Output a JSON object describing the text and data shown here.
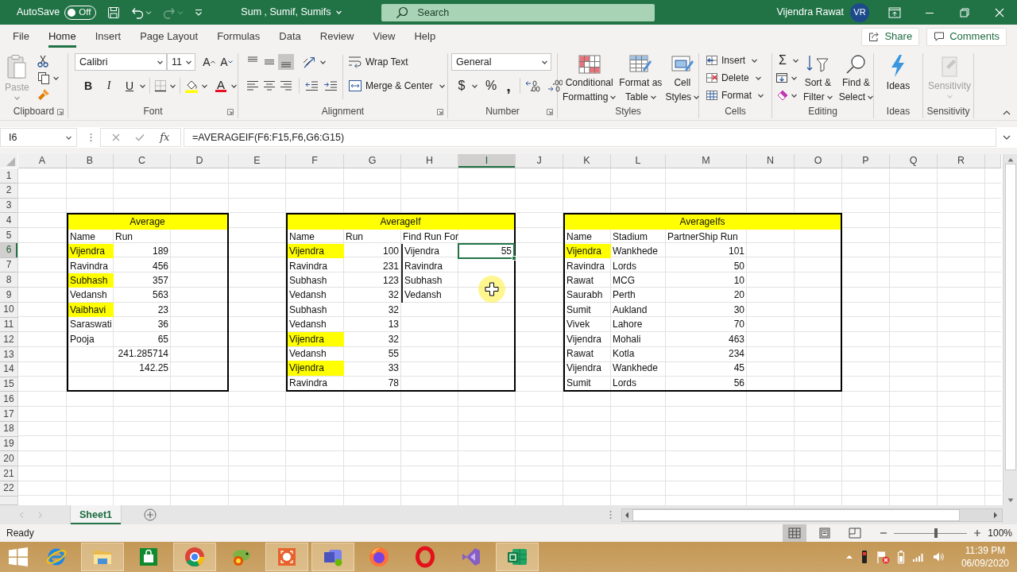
{
  "title_bar": {
    "autosave": {
      "label": "AutoSave",
      "on": false,
      "state_label": "Off"
    },
    "redo": {
      "disabled": true
    },
    "title": "Sum , Sumif, Sumifs",
    "search": {
      "placeholder": "Search"
    },
    "user": "Vijendra Rawat",
    "initials": "VR"
  },
  "menu": {
    "tabs": [
      {
        "label": "File",
        "selected": false
      },
      {
        "label": "Home",
        "selected": true
      },
      {
        "label": "Insert",
        "selected": false
      },
      {
        "label": "Page Layout",
        "selected": false
      },
      {
        "label": "Formulas",
        "selected": false
      },
      {
        "label": "Data",
        "selected": false
      },
      {
        "label": "Review",
        "selected": false
      },
      {
        "label": "View",
        "selected": false
      },
      {
        "label": "Help",
        "selected": false
      }
    ],
    "share": "Share",
    "comments": "Comments"
  },
  "ribbon": {
    "groups": [
      {
        "kind": "clipboard",
        "label": "Clipboard",
        "paste": {
          "label": "Paste",
          "disabled": true
        }
      },
      {
        "kind": "font",
        "label": "Font",
        "font": "Calibri",
        "size": "11",
        "grow": "A",
        "shrink": "A",
        "bold": "B",
        "italic": "I",
        "underline": "U",
        "font_color": "A"
      },
      {
        "kind": "alignment",
        "label": "Alignment",
        "vertical": [
          {
            "selected": false
          },
          {
            "selected": false
          },
          {
            "selected": true
          }
        ],
        "horizontal": [
          {
            "selected": false
          },
          {
            "selected": false
          },
          {
            "selected": false
          }
        ],
        "wrap": "Wrap Text",
        "merge": "Merge & Center"
      },
      {
        "kind": "number",
        "label": "Number",
        "format": "General",
        "currency": "$",
        "percent": "%",
        "comma": ","
      },
      {
        "kind": "styles",
        "label": "Styles",
        "buttons": [
          {
            "lines": [
              "Conditional",
              "Formatting"
            ]
          },
          {
            "lines": [
              "Format as",
              "Table"
            ]
          },
          {
            "lines": [
              "Cell",
              "Styles"
            ]
          }
        ]
      },
      {
        "kind": "cells",
        "label": "Cells",
        "buttons": [
          "Insert",
          "Delete",
          "Format"
        ]
      },
      {
        "kind": "editing",
        "label": "Editing",
        "autosum": "Σ",
        "buttons": [
          {
            "lines": [
              "Sort &",
              "Filter"
            ]
          },
          {
            "lines": [
              "Find &",
              "Select"
            ]
          }
        ]
      },
      {
        "kind": "ideas",
        "label": "Ideas",
        "button": "Ideas"
      },
      {
        "kind": "sensitivity",
        "label": "Sensitivity",
        "button": "Sensitivity",
        "disabled": true
      }
    ]
  },
  "formula_bar": {
    "name_box": "I6",
    "function_label": "fx",
    "formula": "=AVERAGEIF(F6:F15,F6,G6:G15)"
  },
  "sheet": {
    "columns": [
      {
        "label": "A",
        "selected": false
      },
      {
        "label": "B",
        "selected": false
      },
      {
        "label": "C",
        "selected": false
      },
      {
        "label": "D",
        "selected": false
      },
      {
        "label": "E",
        "selected": false
      },
      {
        "label": "F",
        "selected": false
      },
      {
        "label": "G",
        "selected": false
      },
      {
        "label": "H",
        "selected": false
      },
      {
        "label": "I",
        "selected": true
      },
      {
        "label": "J",
        "selected": false
      },
      {
        "label": "K",
        "selected": false
      },
      {
        "label": "L",
        "selected": false
      },
      {
        "label": "M",
        "selected": false
      },
      {
        "label": "N",
        "selected": false
      },
      {
        "label": "O",
        "selected": false
      },
      {
        "label": "P",
        "selected": false
      },
      {
        "label": "Q",
        "selected": false
      },
      {
        "label": "R",
        "selected": false
      }
    ],
    "rows": [
      {
        "label": "1",
        "selected": false
      },
      {
        "label": "2",
        "selected": false
      },
      {
        "label": "3",
        "selected": false
      },
      {
        "label": "4",
        "selected": false
      },
      {
        "label": "5",
        "selected": false
      },
      {
        "label": "6",
        "selected": true
      },
      {
        "label": "7",
        "selected": false
      },
      {
        "label": "8",
        "selected": false
      },
      {
        "label": "9",
        "selected": false
      },
      {
        "label": "10",
        "selected": false
      },
      {
        "label": "11",
        "selected": false
      },
      {
        "label": "12",
        "selected": false
      },
      {
        "label": "13",
        "selected": false
      },
      {
        "label": "14",
        "selected": false
      },
      {
        "label": "15",
        "selected": false
      },
      {
        "label": "16",
        "selected": false
      },
      {
        "label": "17",
        "selected": false
      },
      {
        "label": "18",
        "selected": false
      },
      {
        "label": "19",
        "selected": false
      },
      {
        "label": "20",
        "selected": false
      },
      {
        "label": "21",
        "selected": false
      },
      {
        "label": "22",
        "selected": false
      }
    ],
    "tables": [
      {
        "kind": "average",
        "title": "Average",
        "header": [
          "Name",
          "Run"
        ],
        "rows": [
          {
            "name": "Vijendra",
            "run": "189",
            "highlighted": true
          },
          {
            "name": "Ravindra",
            "run": "456",
            "highlighted": false
          },
          {
            "name": "Subhash",
            "run": "357",
            "highlighted": true
          },
          {
            "name": "Vedansh",
            "run": "563",
            "highlighted": false
          },
          {
            "name": "Vaibhavi",
            "run": "23",
            "highlighted": true
          },
          {
            "name": "Saraswati",
            "run": "36",
            "highlighted": false
          },
          {
            "name": "Pooja",
            "run": "65",
            "highlighted": false
          }
        ],
        "results": [
          "241.285714",
          "142.25"
        ]
      },
      {
        "kind": "averageif",
        "title": "AverageIf",
        "header": [
          "Name",
          "Run",
          "Find Run For"
        ],
        "rows": [
          {
            "name": "Vijendra",
            "run": "100",
            "highlighted": true
          },
          {
            "name": "Ravindra",
            "run": "231",
            "highlighted": false
          },
          {
            "name": "Subhash",
            "run": "123",
            "highlighted": false
          },
          {
            "name": "Vedansh",
            "run": "32",
            "highlighted": false
          },
          {
            "name": "Subhash",
            "run": "32",
            "highlighted": false
          },
          {
            "name": "Vedansh",
            "run": "13",
            "highlighted": false
          },
          {
            "name": "Vijendra",
            "run": "32",
            "highlighted": true
          },
          {
            "name": "Vedansh",
            "run": "55",
            "highlighted": false
          },
          {
            "name": "Vijendra",
            "run": "33",
            "highlighted": true
          },
          {
            "name": "Ravindra",
            "run": "78",
            "highlighted": false
          }
        ],
        "lookup": [
          {
            "name": "Vijendra",
            "result": {
              "text": "55",
              "selected": true
            }
          },
          {
            "name": "Ravindra"
          },
          {
            "name": "Subhash"
          },
          {
            "name": "Vedansh"
          }
        ]
      },
      {
        "kind": "averageifs",
        "title": "AverageIfs",
        "header": [
          "Name",
          "Stadium",
          "PartnerShip Run"
        ],
        "rows": [
          {
            "name": "Vijendra",
            "stadium": "Wankhede",
            "run": "101",
            "highlighted": true
          },
          {
            "name": "Ravindra",
            "stadium": "Lords",
            "run": "50",
            "highlighted": false
          },
          {
            "name": "Rawat",
            "stadium": "MCG",
            "run": "10",
            "highlighted": false
          },
          {
            "name": "Saurabh",
            "stadium": "Perth",
            "run": "20",
            "highlighted": false
          },
          {
            "name": "Sumit",
            "stadium": "Aukland",
            "run": "30",
            "highlighted": false
          },
          {
            "name": "Vivek",
            "stadium": "Lahore",
            "run": "70",
            "highlighted": false
          },
          {
            "name": "Vijendra",
            "stadium": "Mohali",
            "run": "463",
            "highlighted": false
          },
          {
            "name": "Rawat",
            "stadium": "Kotla",
            "run": "234",
            "highlighted": false
          },
          {
            "name": "Vijendra",
            "stadium": "Wankhede",
            "run": "45",
            "highlighted": false
          },
          {
            "name": "Sumit",
            "stadium": "Lords",
            "run": "56",
            "highlighted": false
          }
        ]
      }
    ]
  },
  "sheet_tabs": {
    "tabs": [
      {
        "label": "Sheet1",
        "selected": true
      }
    ]
  },
  "status_bar": {
    "text": "Ready",
    "views": [
      {
        "kind": "normal",
        "selected": true
      },
      {
        "kind": "page_layout",
        "selected": false
      },
      {
        "kind": "page_break",
        "selected": false
      }
    ],
    "zoom": {
      "level": 0.57
    },
    "zoom_label": "100%"
  },
  "taskbar": {
    "apps": [
      {
        "kind": "browser_e",
        "running": false
      },
      {
        "kind": "folder",
        "running": true
      },
      {
        "kind": "store",
        "running": false
      },
      {
        "kind": "chrome",
        "running": true
      },
      {
        "kind": "chameleon",
        "running": false
      },
      {
        "kind": "capture",
        "running": true
      },
      {
        "kind": "teams",
        "running": true
      },
      {
        "kind": "firefox",
        "running": false
      },
      {
        "kind": "opera",
        "running": false
      },
      {
        "kind": "vs",
        "running": false
      },
      {
        "kind": "excel",
        "running": true
      }
    ],
    "time": "11:39 PM",
    "date": "06/09/2020"
  }
}
